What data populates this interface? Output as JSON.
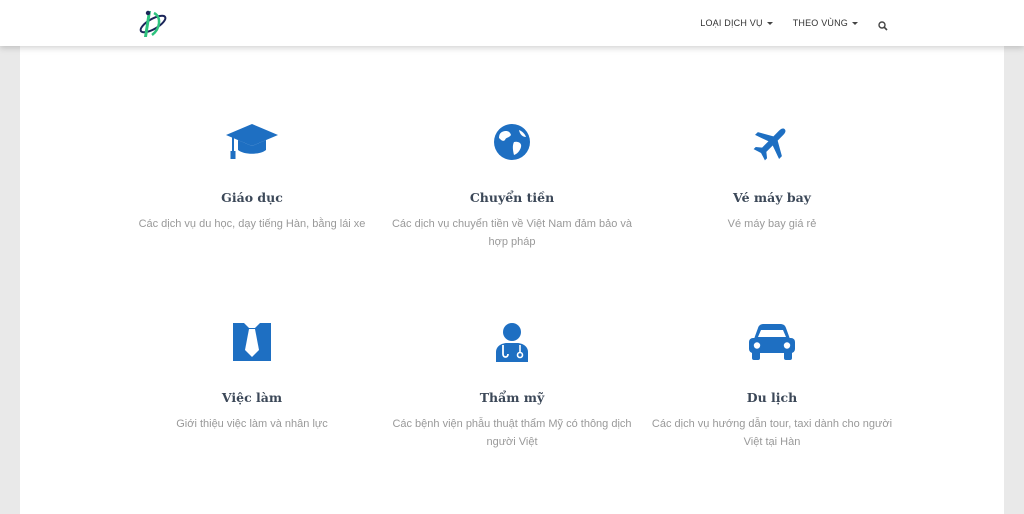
{
  "nav": {
    "items": [
      {
        "label": "LOẠI DỊCH VỤ"
      },
      {
        "label": "THEO VÙNG"
      }
    ]
  },
  "colors": {
    "accent": "#1e6fc2",
    "logo_green": "#2ec27e",
    "logo_navy": "#1b2559"
  },
  "features": [
    {
      "icon": "graduation-cap-icon",
      "title": "Giáo dục",
      "desc": "Các dịch vụ du học, dạy tiếng Hàn, bằng lái xe"
    },
    {
      "icon": "globe-icon",
      "title": "Chuyển tiền",
      "desc": "Các dịch vụ chuyển tiền về Việt Nam đảm bảo và hợp pháp"
    },
    {
      "icon": "plane-icon",
      "title": "Vé máy bay",
      "desc": "Vé máy bay giá rẻ"
    },
    {
      "icon": "tie-icon",
      "title": "Việc làm",
      "desc": "Giới thiệu việc làm và nhân lực"
    },
    {
      "icon": "doctor-icon",
      "title": "Thẩm mỹ",
      "desc": "Các bệnh viện phẫu thuật thẩm Mỹ có thông dịch người Việt"
    },
    {
      "icon": "car-icon",
      "title": "Du lịch",
      "desc": "Các dịch vụ hướng dẫn tour, taxi dành cho người Việt tại Hàn"
    }
  ]
}
